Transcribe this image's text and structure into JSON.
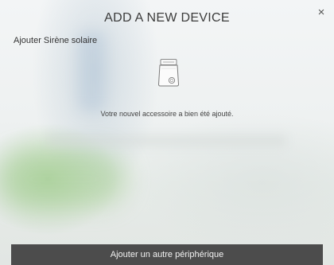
{
  "dialog": {
    "title": "ADD A NEW DEVICE",
    "close_glyph": "×",
    "subtitle": "Ajouter Sirène solaire",
    "device_icon": "solar-siren-icon",
    "message": "Votre nouvel accessoire a bien été ajouté.",
    "footer_button_label": "Ajouter un autre périphérique"
  },
  "colors": {
    "footer_bg": "#4c4c4c",
    "footer_text": "#f2f2f2",
    "title_text": "#3c3c3c"
  }
}
